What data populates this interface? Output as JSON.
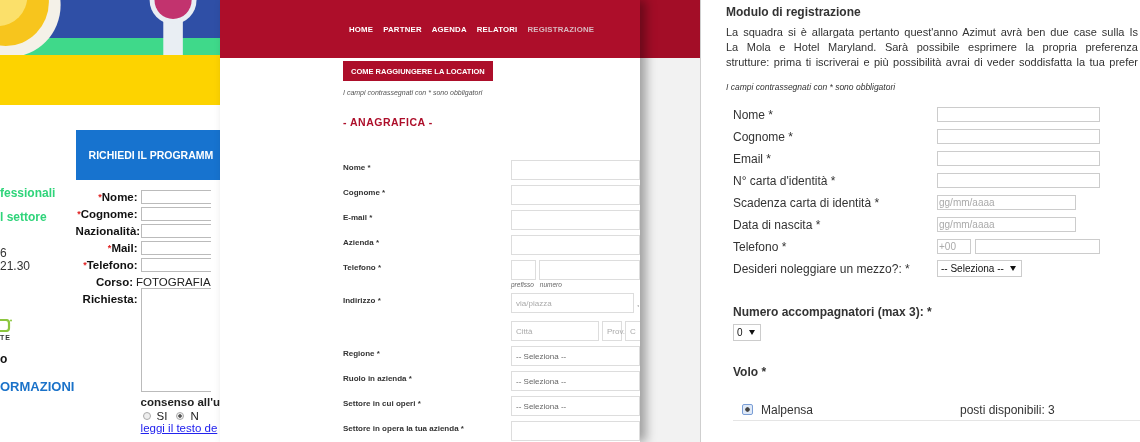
{
  "left_page": {
    "banner_title": "RICHIEDI IL PROGRAMM",
    "side_texts": [
      {
        "kind": "green",
        "text": "fessionali"
      },
      {
        "kind": "green",
        "text": "l settore"
      },
      {
        "kind": "plain",
        "text": "6"
      },
      {
        "kind": "plain",
        "text": "21.30"
      },
      {
        "kind": "logo",
        "text": "TE"
      },
      {
        "kind": "bold",
        "text": "o"
      },
      {
        "kind": "link",
        "text": "ORMAZIONI"
      }
    ],
    "fields": [
      {
        "kind": "input",
        "mark": "*",
        "label": "Nome:"
      },
      {
        "kind": "input",
        "mark": "*",
        "label": "Cognome:"
      },
      {
        "kind": "input",
        "label": "Nazionalità:"
      },
      {
        "kind": "input",
        "mark": "*",
        "label": "Mail:"
      },
      {
        "kind": "input",
        "mark": "*",
        "label": "Telefono:"
      },
      {
        "kind": "value",
        "label": "Corso:",
        "value": "FOTOGRAFIA"
      },
      {
        "kind": "textarea",
        "label": "Richiesta:"
      }
    ],
    "consent": {
      "label": "consenso all'u",
      "options": [
        {
          "label": "SI",
          "selected": false
        },
        {
          "label": "N",
          "selected": true
        }
      ],
      "link": "leggi il testo de"
    }
  },
  "middle_page": {
    "nav": [
      {
        "label": "HOME",
        "selected": false
      },
      {
        "label": "PARTNER",
        "selected": false
      },
      {
        "label": "AGENDA",
        "selected": false
      },
      {
        "label": "RELATORI",
        "selected": false
      },
      {
        "label": "REGISTRAZIONE",
        "selected": true
      }
    ],
    "location_button": "COME RAGGIUNGERE LA LOCATION",
    "note": "I campi contrassegnati con * sono obbligatori",
    "section": "- ANAGRAFICA -",
    "fields": [
      {
        "kind": "text",
        "label": "Nome *"
      },
      {
        "kind": "text",
        "label": "Cognome *"
      },
      {
        "kind": "text",
        "label": "E-mail *"
      },
      {
        "kind": "text",
        "label": "Azienda *"
      },
      {
        "kind": "phone",
        "label": "Telefono *",
        "sublabels": [
          "prefisso",
          "numero"
        ]
      },
      {
        "kind": "address",
        "label": "Indirizzo *",
        "placeholders": [
          "via/piazza",
          "Città",
          "Prov.",
          "C"
        ],
        "separator": ","
      },
      {
        "kind": "select",
        "label": "Regione *",
        "value": "-- Seleziona --"
      },
      {
        "kind": "select",
        "label": "Ruolo in azienda *",
        "value": "-- Seleziona --"
      },
      {
        "kind": "select",
        "label": "Settore in cui operi *",
        "value": "-- Seleziona --"
      },
      {
        "kind": "select",
        "label": "Settore in opera la tua azienda *"
      }
    ]
  },
  "right_page": {
    "title": "Modulo di registrazione",
    "intro_lines": [
      "La squadra si è allargata pertanto quest'anno Azimut avrà ben due case sulla Is",
      "La Mola e Hotel Maryland. Sarà possibile esprimere la propria preferenza",
      "strutture: prima ti iscriverai e più possibilità avrai di veder soddisfatta la tua prefer"
    ],
    "note": "I campi contrassegnati con * sono obbligatori",
    "fields": [
      {
        "kind": "text",
        "label": "Nome *"
      },
      {
        "kind": "text",
        "label": "Cognome *"
      },
      {
        "kind": "text",
        "label": "Email *"
      },
      {
        "kind": "text",
        "label": "N° carta d'identità *"
      },
      {
        "kind": "date",
        "label": "Scadenza carta di identità *",
        "placeholder": "gg/mm/aaaa"
      },
      {
        "kind": "date",
        "label": "Data di nascita *",
        "placeholder": "gg/mm/aaaa"
      },
      {
        "kind": "phone",
        "label": "Telefono *",
        "placeholder": "+00"
      },
      {
        "kind": "select",
        "label": "Desideri noleggiare un mezzo?: *",
        "value": "-- Seleziona --"
      }
    ],
    "companions": {
      "label": "Numero accompagnatori (max 3): *",
      "value": "0"
    },
    "flight": {
      "label": "Volo *",
      "options": [
        {
          "name": "Malpensa",
          "availability": "posti disponibili: 3",
          "selected": true
        }
      ]
    }
  }
}
